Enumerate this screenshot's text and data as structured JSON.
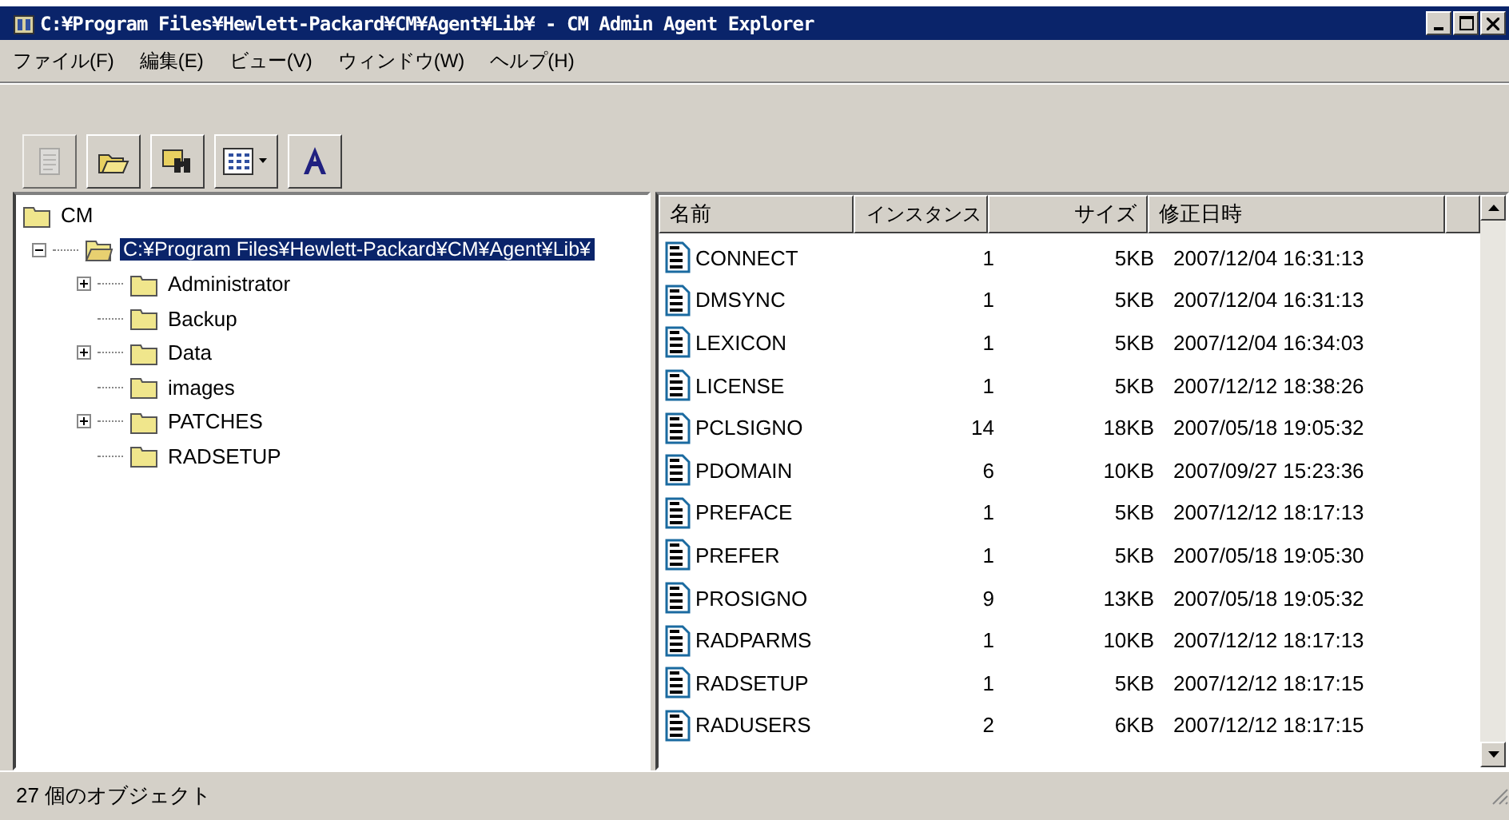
{
  "window": {
    "title": "C:¥Program Files¥Hewlett-Packard¥CM¥Agent¥Lib¥ - CM Admin Agent Explorer"
  },
  "menu": [
    "ファイル(F)",
    "編集(E)",
    "ビュー(V)",
    "ウィンドウ(W)",
    "ヘルプ(H)"
  ],
  "toolbar": [
    {
      "kind": "page",
      "disabled": true
    },
    {
      "kind": "open",
      "disabled": false
    },
    {
      "kind": "find",
      "disabled": false
    },
    {
      "kind": "view",
      "disabled": false
    },
    {
      "kind": "font",
      "disabled": false
    }
  ],
  "tree": {
    "label": "CM",
    "selected": false,
    "children": [
      {
        "label": "C:¥Program Files¥Hewlett-Packard¥CM¥Agent¥Lib¥",
        "selected": true,
        "expanded": true,
        "children": [
          {
            "label": "Administrator",
            "selected": false,
            "expanded": false
          },
          {
            "label": "Backup",
            "selected": false
          },
          {
            "label": "Data",
            "selected": false,
            "expanded": false
          },
          {
            "label": "images",
            "selected": false
          },
          {
            "label": "PATCHES",
            "selected": false,
            "expanded": false
          },
          {
            "label": "RADSETUP",
            "selected": false
          }
        ]
      }
    ]
  },
  "table": {
    "columns": [
      "名前",
      "インスタンス",
      "サイズ",
      "修正日時"
    ],
    "rows": [
      {
        "selected": false,
        "cells": [
          "CONNECT",
          "1",
          "5KB",
          "2007/12/04 16:31:13"
        ]
      },
      {
        "selected": false,
        "cells": [
          "DMSYNC",
          "1",
          "5KB",
          "2007/12/04 16:31:13"
        ]
      },
      {
        "selected": false,
        "cells": [
          "LEXICON",
          "1",
          "5KB",
          "2007/12/04 16:34:03"
        ]
      },
      {
        "selected": false,
        "cells": [
          "LICENSE",
          "1",
          "5KB",
          "2007/12/12 18:38:26"
        ]
      },
      {
        "selected": false,
        "cells": [
          "PCLSIGNO",
          "14",
          "18KB",
          "2007/05/18 19:05:32"
        ]
      },
      {
        "selected": false,
        "cells": [
          "PDOMAIN",
          "6",
          "10KB",
          "2007/09/27 15:23:36"
        ]
      },
      {
        "selected": false,
        "cells": [
          "PREFACE",
          "1",
          "5KB",
          "2007/12/12 18:17:13"
        ]
      },
      {
        "selected": false,
        "cells": [
          "PREFER",
          "1",
          "5KB",
          "2007/05/18 19:05:30"
        ]
      },
      {
        "selected": false,
        "cells": [
          "PROSIGNO",
          "9",
          "13KB",
          "2007/05/18 19:05:32"
        ]
      },
      {
        "selected": false,
        "cells": [
          "RADPARMS",
          "1",
          "10KB",
          "2007/12/12 18:17:13"
        ]
      },
      {
        "selected": false,
        "cells": [
          "RADSETUP",
          "1",
          "5KB",
          "2007/12/12 18:17:15"
        ]
      },
      {
        "selected": false,
        "cells": [
          "RADUSERS",
          "2",
          "6KB",
          "2007/12/12 18:17:15"
        ]
      }
    ]
  },
  "status_bar": "27 個のオブジェクト"
}
